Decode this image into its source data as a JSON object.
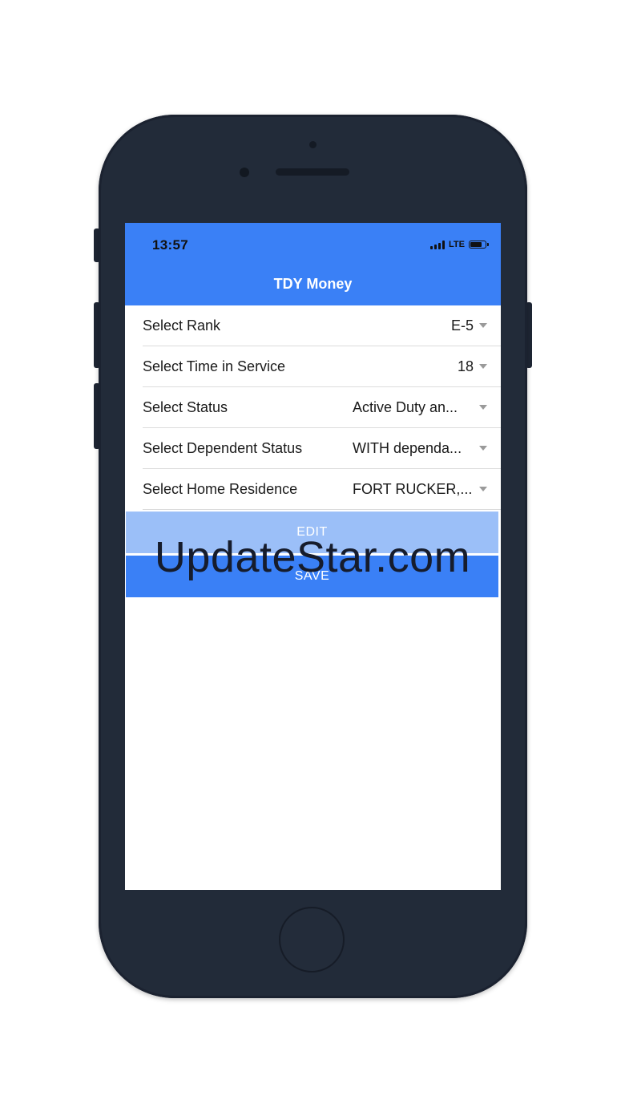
{
  "status_bar": {
    "time": "13:57",
    "network": "LTE"
  },
  "app": {
    "title": "TDY Money"
  },
  "form": {
    "rows": [
      {
        "label": "Select Rank",
        "value": "E-5"
      },
      {
        "label": "Select Time in Service",
        "value": "18"
      },
      {
        "label": "Select Status",
        "value": "Active Duty an..."
      },
      {
        "label": "Select Dependent Status",
        "value": "WITH dependa..."
      },
      {
        "label": "Select Home Residence",
        "value": "FORT RUCKER,..."
      }
    ]
  },
  "buttons": {
    "edit_label": "EDIT",
    "save_label": "SAVE"
  },
  "watermark": {
    "text": "UpdateStar.com"
  },
  "colors": {
    "primary": "#3a80f6",
    "primary_light": "#9bbff8",
    "phone_body": "#222b39"
  },
  "icons": [
    "signal-icon",
    "battery-icon",
    "caret-down-icon"
  ]
}
